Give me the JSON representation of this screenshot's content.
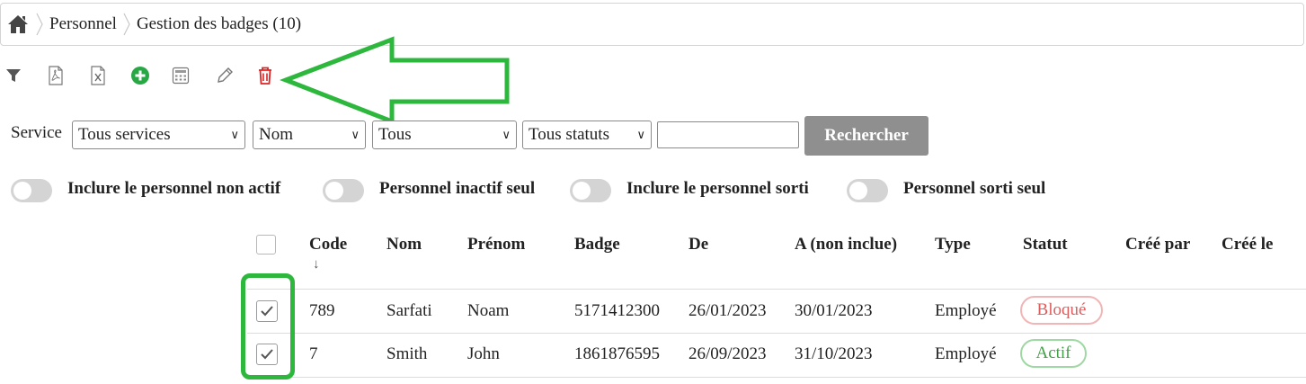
{
  "breadcrumb": {
    "items": [
      "Personnel",
      "Gestion des badges (10)"
    ]
  },
  "toolbar": {
    "icons": [
      "filter-icon",
      "pdf-icon",
      "excel-icon",
      "add-icon",
      "calculator-icon",
      "edit-icon",
      "delete-icon"
    ]
  },
  "filters": {
    "label": "Service",
    "service": "Tous services",
    "field": "Nom",
    "scope": "Tous",
    "status": "Tous statuts",
    "search_value": "",
    "button": "Rechercher"
  },
  "toggles": [
    {
      "label": "Inclure le personnel non actif",
      "on": false
    },
    {
      "label": "Personnel inactif seul",
      "on": false
    },
    {
      "label": "Inclure le personnel sorti",
      "on": false
    },
    {
      "label": "Personnel sorti seul",
      "on": false
    }
  ],
  "table": {
    "sort_indicator": "↓",
    "columns": [
      "Code",
      "Nom",
      "Prénom",
      "Badge",
      "De",
      "A (non inclue)",
      "Type",
      "Statut",
      "Créé par",
      "Créé le"
    ],
    "rows": [
      {
        "checked": true,
        "code": "789",
        "nom": "Sarfati",
        "prenom": "Noam",
        "badge": "5171412300",
        "de": "26/01/2023",
        "a": "30/01/2023",
        "type": "Employé",
        "statut": "Bloqué",
        "cree_par": "",
        "cree_le": ""
      },
      {
        "checked": true,
        "code": "7",
        "nom": "Smith",
        "prenom": "John",
        "badge": "1861876595",
        "de": "26/09/2023",
        "a": "31/10/2023",
        "type": "Employé",
        "statut": "Actif",
        "cree_par": "",
        "cree_le": ""
      }
    ]
  },
  "colors": {
    "annotation": "#2db83d",
    "status_blocked": "#e57373",
    "status_active": "#4caf50",
    "add": "#27a844",
    "delete": "#e02424",
    "button_bg": "#8f8f8f"
  }
}
